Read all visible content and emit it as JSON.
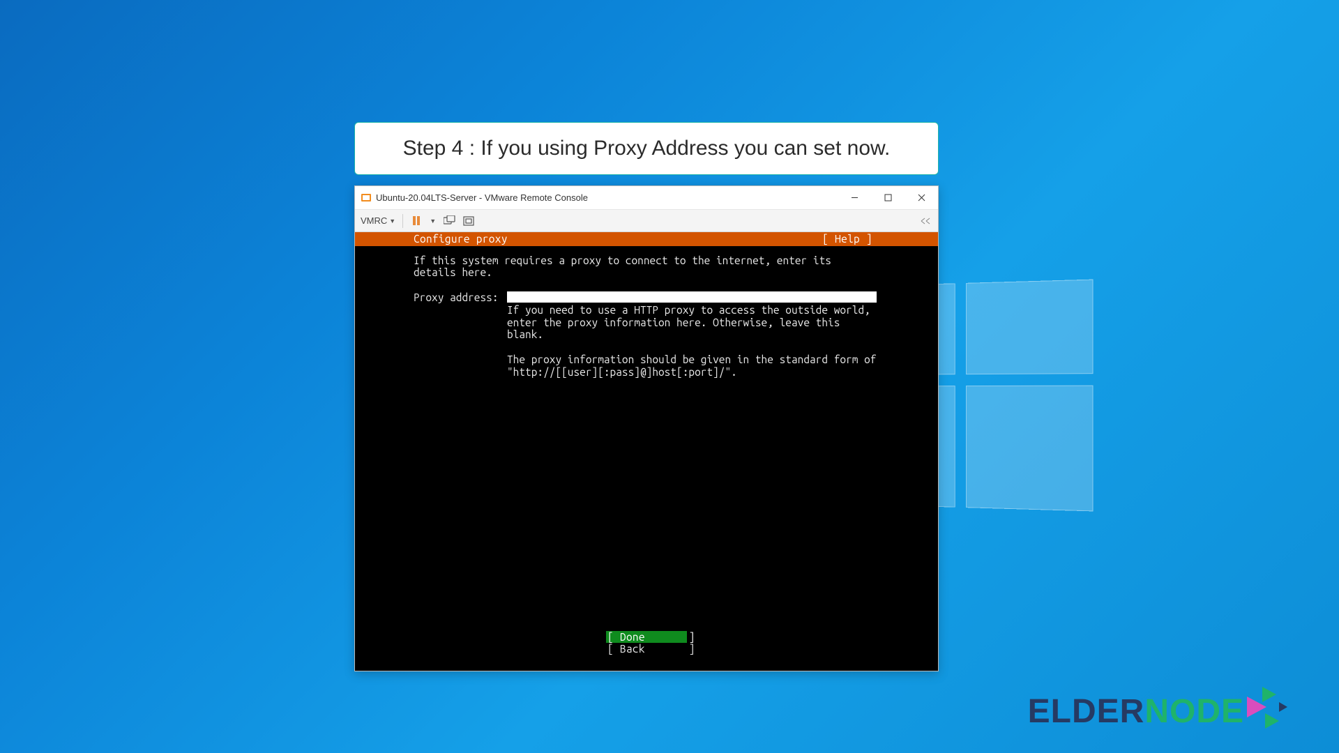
{
  "annotation": {
    "text": "Step 4 : If you using Proxy Address you can set now."
  },
  "window": {
    "title": "Ubuntu-20.04LTS-Server - VMware Remote Console",
    "controls": {
      "min": "—",
      "max": "▢",
      "close": "✕"
    }
  },
  "toolbar": {
    "menu_label": "VMRC"
  },
  "installer": {
    "title": "Configure proxy",
    "help": "[ Help ]",
    "instruction": "If this system requires a proxy to connect to the internet, enter its details here.",
    "proxy_label": "Proxy address:",
    "proxy_value": "",
    "hint1": "If you need to use a HTTP proxy to access the outside world, enter the proxy information here. Otherwise, leave this blank.",
    "hint2": "The proxy information should be given in the standard form of \"http://[[user][:pass]@]host[:port]/\".",
    "done": "[ Done       ]",
    "back": "[ Back       ]"
  },
  "brand": {
    "part1": "Elder",
    "part2": "node"
  }
}
